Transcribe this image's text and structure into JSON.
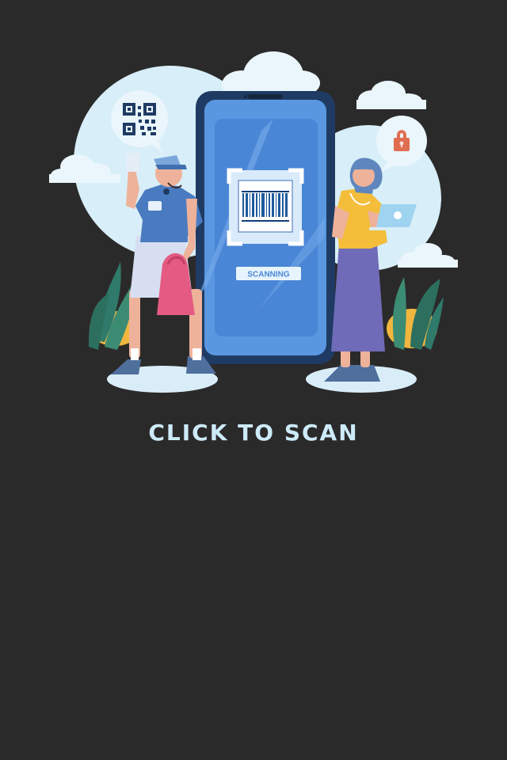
{
  "scan_screen": {
    "scanning_label": "SCANNING",
    "cta_label": "CLICK TO SCAN"
  },
  "colors": {
    "background": "#2b2a2a",
    "accent_light_blue": "#cdeaf8",
    "phone_blue": "#4a86d6",
    "phone_frame": "#1f3b63",
    "bag_pink": "#e55a82",
    "dress_purple": "#6f6bb8",
    "top_yellow": "#f4bd3a"
  },
  "icons": {
    "qr_code_bubble": "qr-code-icon",
    "padlock_bubble": "lock-icon",
    "barcode_frame": "barcode-icon"
  }
}
